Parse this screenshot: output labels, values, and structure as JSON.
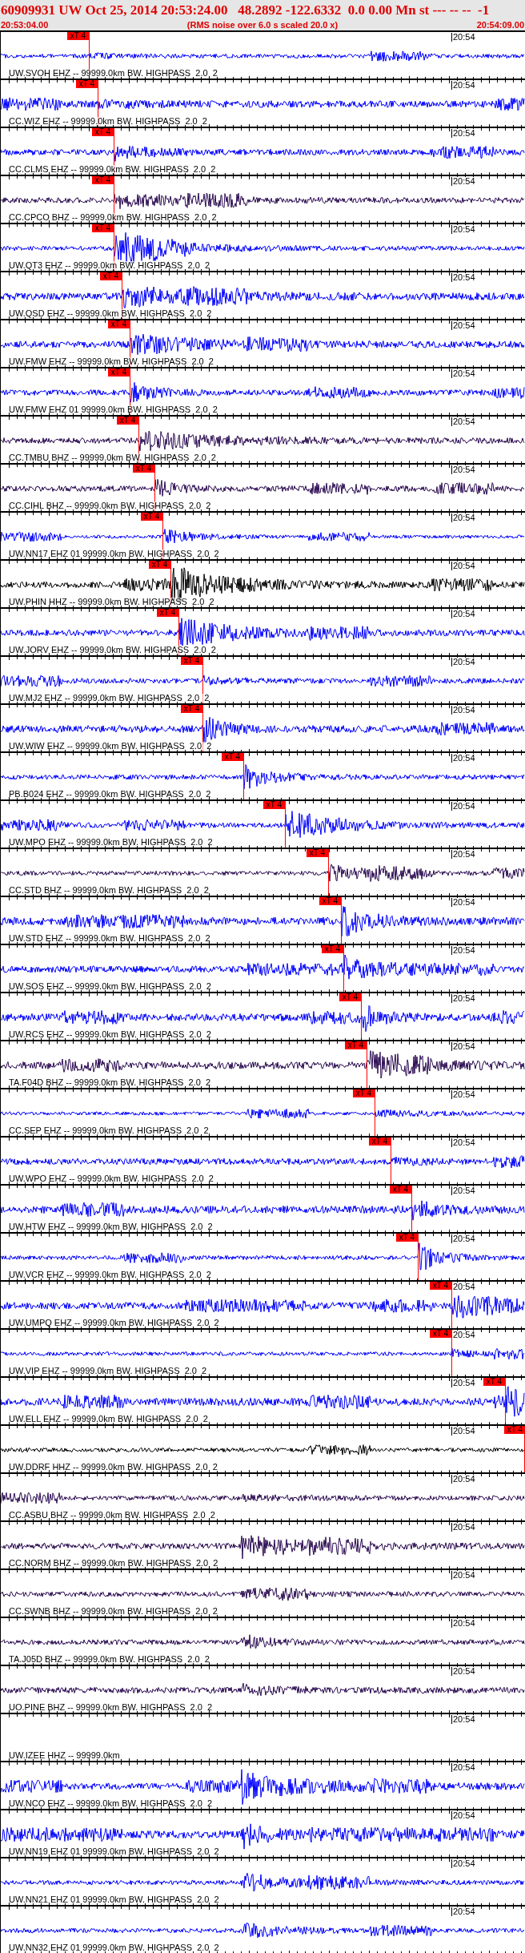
{
  "header": {
    "title": "60909931 UW Oct 25, 2014 20:53:24.00   48.2892 -122.6332  0.0 0.00 Mn st --- -- --  -1",
    "start_time": "20:53:04.00",
    "note": "(RMS noise over 6.0 s scaled 20.0 x)",
    "end_time": "20:54:09.00"
  },
  "traces": [
    {
      "label": "UW.SVOH EHZ -- 99999.0km BW. HIGHPASS  2.0  2",
      "color": "#0000ff",
      "kind": "waveform",
      "pick": "xT 4",
      "minute_label": "20:54"
    },
    {
      "label": "CC.WIZ EHZ -- 99999.0km BW. HIGHPASS  2.0  2",
      "color": "#0000ff",
      "kind": "waveform",
      "pick": "xT 4",
      "minute_label": "20:54"
    },
    {
      "label": "CC.CLMS EHZ -- 99999.0km BW. HIGHPASS  2.0  2",
      "color": "#0000ff",
      "kind": "waveform",
      "pick": "xT 4",
      "minute_label": "20:54"
    },
    {
      "label": "CC.CPCO BHZ -- 99999.0km BW. HIGHPASS  2.0  2",
      "color": "#2a0a50",
      "kind": "waveform",
      "pick": "xT 4",
      "minute_label": "20:54"
    },
    {
      "label": "UW.QT3 EHZ -- 99999.0km BW. HIGHPASS  2.0  2",
      "color": "#0000ff",
      "kind": "waveform",
      "pick": "xT 4",
      "minute_label": "20:54"
    },
    {
      "label": "UW.QSD EHZ -- 99999.0km BW. HIGHPASS  2.0  2",
      "color": "#0000ff",
      "kind": "waveform",
      "pick": "xT 4",
      "minute_label": "20:54"
    },
    {
      "label": "UW.FMW EHZ -- 99999.0km BW. HIGHPASS  2.0  2",
      "color": "#0000ff",
      "kind": "waveform",
      "pick": "xT 4",
      "minute_label": "20:54"
    },
    {
      "label": "UW.FMW EHZ 01 99999.0km BW. HIGHPASS  2.0  2",
      "color": "#0000ff",
      "kind": "waveform",
      "pick": "xT 4",
      "minute_label": "20:54"
    },
    {
      "label": "CC.TMBU BHZ -- 99999.0km BW. HIGHPASS  2.0  2",
      "color": "#2a0a50",
      "kind": "waveform",
      "pick": "xT 4",
      "minute_label": "20:54"
    },
    {
      "label": "CC.CIHL BHZ -- 99999.0km BW. HIGHPASS  2.0  2",
      "color": "#2a0a50",
      "kind": "waveform",
      "pick": "xT 4",
      "minute_label": "20:54"
    },
    {
      "label": "UW.NN17 EHZ 01 99999.0km BW. HIGHPASS  2.0  2",
      "color": "#0000ff",
      "kind": "waveform",
      "pick": "xT 4",
      "minute_label": "20:54"
    },
    {
      "label": "UW.PHIN HHZ -- 99999.0km BW. HIGHPASS  2.0  2",
      "color": "#000000",
      "kind": "waveform",
      "pick": "xT 4",
      "minute_label": "20:54"
    },
    {
      "label": "UW.JORV EHZ -- 99999.0km BW. HIGHPASS  2.0  2",
      "color": "#0000ff",
      "kind": "waveform",
      "pick": "xT 4",
      "minute_label": "20:54"
    },
    {
      "label": "UW.MJ2 EHZ -- 99999.0km BW. HIGHPASS  2.0  2",
      "color": "#0000ff",
      "kind": "waveform",
      "pick": "xT 4",
      "minute_label": "20:54"
    },
    {
      "label": "UW.WIW EHZ -- 99999.0km BW. HIGHPASS  2.0  2",
      "color": "#0000ff",
      "kind": "waveform",
      "pick": "xT 4",
      "minute_label": "20:54"
    },
    {
      "label": "PB.B024 EHZ -- 99999.0km BW. HIGHPASS  2.0  2",
      "color": "#0000ff",
      "kind": "waveform",
      "pick": "xT 4",
      "minute_label": "20:54"
    },
    {
      "label": "UW.MPO EHZ -- 99999.0km BW. HIGHPASS  2.0  2",
      "color": "#0000ff",
      "kind": "waveform",
      "pick": "xT 4",
      "minute_label": "20:54"
    },
    {
      "label": "CC.STD BHZ -- 99999.0km BW. HIGHPASS  2.0  2",
      "color": "#2a0a50",
      "kind": "waveform",
      "pick": "xT 4",
      "minute_label": "20:54"
    },
    {
      "label": "UW.STD EHZ -- 99999.0km BW. HIGHPASS  2.0  2",
      "color": "#0000ff",
      "kind": "waveform",
      "pick": "xT 4",
      "minute_label": "20:54"
    },
    {
      "label": "UW.SOS EHZ -- 99999.0km BW. HIGHPASS  2.0  2",
      "color": "#0000ff",
      "kind": "waveform",
      "pick": "xT 4",
      "minute_label": "20:54"
    },
    {
      "label": "UW.RCS EHZ -- 99999.0km BW. HIGHPASS  2.0  2",
      "color": "#0000ff",
      "kind": "waveform",
      "pick": "xT 4",
      "minute_label": "20:54"
    },
    {
      "label": "TA.F04D BHZ -- 99999.0km BW. HIGHPASS  2.0  2",
      "color": "#2a0a50",
      "kind": "waveform",
      "pick": "xT 4",
      "minute_label": "20:54"
    },
    {
      "label": "CC.SEP EHZ -- 99999.0km BW. HIGHPASS  2.0  2",
      "color": "#0000ff",
      "kind": "waveform",
      "pick": "xT 4",
      "minute_label": "20:54"
    },
    {
      "label": "UW.WPO EHZ -- 99999.0km BW. HIGHPASS  2.0  2",
      "color": "#0000ff",
      "kind": "waveform",
      "pick": "xT 4",
      "minute_label": "20:54"
    },
    {
      "label": "UW.HTW EHZ -- 99999.0km BW. HIGHPASS  2.0  2",
      "color": "#0000ff",
      "kind": "waveform",
      "pick": "xT 4",
      "minute_label": "20:54"
    },
    {
      "label": "UW.VCR EHZ -- 99999.0km BW. HIGHPASS  2.0  2",
      "color": "#0000ff",
      "kind": "waveform",
      "pick": "xT 4",
      "minute_label": "20:54"
    },
    {
      "label": "UW.UMPQ EHZ -- 99999.0km BW. HIGHPASS  2.0  2",
      "color": "#0000ff",
      "kind": "waveform",
      "pick": "xT 4",
      "minute_label": "20:54"
    },
    {
      "label": "UW.VIP EHZ -- 99999.0km BW. HIGHPASS  2.0  2",
      "color": "#0000ff",
      "kind": "waveform",
      "pick": "xT 4",
      "minute_label": "20:54"
    },
    {
      "label": "UW.ELL EHZ -- 99999.0km BW. HIGHPASS  2.0  2",
      "color": "#0000ff",
      "kind": "waveform",
      "pick": "xT 4",
      "minute_label": "20:54"
    },
    {
      "label": "UW.DDRF HHZ -- 99999.0km BW. HIGHPASS  2.0  2",
      "color": "#000000",
      "kind": "waveform",
      "pick": "xT 4",
      "minute_label": "20:54"
    },
    {
      "label": "CC.ASBU BHZ -- 99999.0km BW. HIGHPASS  2.0  2",
      "color": "#2a0a50",
      "kind": "waveform",
      "minute_label": "20:54"
    },
    {
      "label": "CC.NORM BHZ -- 99999.0km BW. HIGHPASS  2.0  2",
      "color": "#2a0a50",
      "kind": "waveform",
      "minute_label": "20:54"
    },
    {
      "label": "CC.SWNB BHZ -- 99999.0km BW. HIGHPASS  2.0  2",
      "color": "#2a0a50",
      "kind": "waveform",
      "minute_label": "20:54"
    },
    {
      "label": "TA.J05D BHZ -- 99999.0km BW. HIGHPASS  2.0  2",
      "color": "#2a0a50",
      "kind": "waveform",
      "minute_label": "20:54"
    },
    {
      "label": "UO.PINE BHZ -- 99999.0km BW. HIGHPASS  2.0  2",
      "color": "#2a0a50",
      "kind": "waveform",
      "minute_label": "20:54"
    },
    {
      "label": "UW.IZEE HHZ -- 99999.0km",
      "kind": "flat",
      "minute_label": "20:54"
    },
    {
      "label": "UW.NCO EHZ -- 99999.0km BW. HIGHPASS  2.0  2",
      "color": "#0000ff",
      "kind": "waveform",
      "minute_label": "20:54"
    },
    {
      "label": "UW.NN19 EHZ 01 99999.0km BW. HIGHPASS  2.0  2",
      "color": "#0000ff",
      "kind": "waveform",
      "minute_label": "20:54"
    },
    {
      "label": "UW.NN21 EHZ 01 99999.0km BW. HIGHPASS  2.0  2",
      "color": "#0000ff",
      "kind": "waveform",
      "minute_label": "20:54"
    },
    {
      "label": "UW.NN32 EHZ 01 99999.0km BW. HIGHPASS  2.0  2",
      "color": "#0000ff",
      "kind": "waveform",
      "minute_label": "20:54"
    }
  ]
}
